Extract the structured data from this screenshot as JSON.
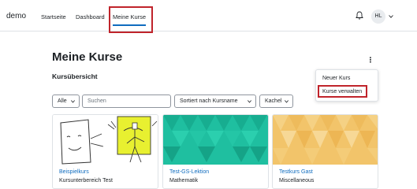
{
  "header": {
    "brand": "demo",
    "nav": [
      "Startseite",
      "Dashboard",
      "Meine Kurse"
    ],
    "user_initials": "HL"
  },
  "main": {
    "title": "Meine Kurse",
    "section": "Kursübersicht",
    "menu_items": [
      "Neuer Kurs",
      "Kurse verwalten"
    ],
    "filters": {
      "status": "Alle",
      "search_placeholder": "Suchen",
      "sort": "Sortiert nach Kursname",
      "view": "Kachel"
    },
    "courses": [
      {
        "name": "Beispielkurs",
        "category": "Kursunterbereich Test",
        "image": "line-drawing-illustration"
      },
      {
        "name": "Test-GS-Lektion",
        "category": "Mathematik",
        "image": "teal-geometric-pattern"
      },
      {
        "name": "Testkurs Gast",
        "category": "Miscellaneous",
        "image": "amber-geometric-pattern"
      }
    ]
  },
  "colors": {
    "accent": "#0f6cbf",
    "highlight": "#c0242b",
    "teal": "#1fbfa0",
    "amber": "#f2c46a"
  }
}
